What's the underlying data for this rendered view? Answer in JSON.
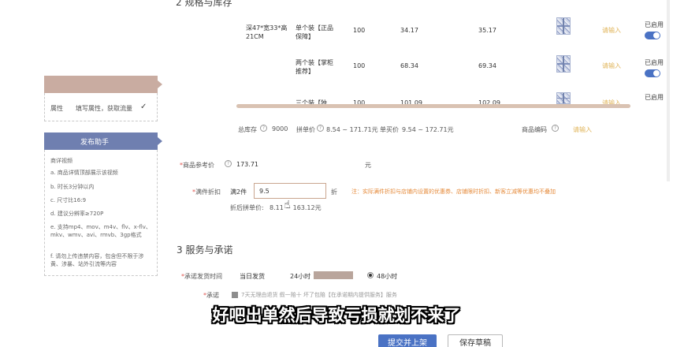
{
  "section2": {
    "title": "2  规格与库存"
  },
  "sku_rows": [
    {
      "spec": "深47*宽33*高21CM",
      "name": "单个装【正品保障】",
      "stock": "100",
      "group_price": "34.17",
      "single_price": "35.17",
      "code_placeholder": "请输入",
      "status": "已启用"
    },
    {
      "spec": "",
      "name": "两个装【掌柜推荐】",
      "stock": "100",
      "group_price": "68.34",
      "single_price": "69.34",
      "code_placeholder": "请输入",
      "status": "已启用"
    },
    {
      "spec": "",
      "name": "三个装【独",
      "stock": "100",
      "group_price": "101.09",
      "single_price": "102.09",
      "code_placeholder": "请输入",
      "status": "已启用"
    }
  ],
  "summary": {
    "total_stock_label": "总库存",
    "total_stock_value": "9000",
    "group_price_label": "拼单价",
    "group_price_range": "8.54 ~ 171.71元",
    "single_price_label": "单买价",
    "single_price_range": "9.54 ~ 172.71元",
    "product_code_label": "商品编码",
    "product_code_placeholder": "请输入"
  },
  "guide": {
    "top_label": "",
    "attr_label": "属性",
    "attr_hint": "填写属性，获取流量",
    "check_mark": "✓"
  },
  "helper": {
    "title": "发布助手",
    "tips": [
      "商详视频",
      "a. 商品详情顶部展示该视频",
      "b. 时长3分钟以内",
      "c. 尺寸比16:9",
      "d. 建议分辨率≥720P",
      "e. 支持mp4、mov、m4v、flv、x-flv、mkv、wmv、avi、rmvb、3gp格式",
      "f. 请勿上传违禁内容，包含但不限于涉黄、涉暴、站外引流等内容"
    ]
  },
  "reference_price": {
    "label": "商品参考价",
    "value": "173.71",
    "unit": "元"
  },
  "discount": {
    "label": "满件折扣",
    "prefix": "满2件",
    "value": "9.5",
    "suffix": "折",
    "note": "注：实际满件折扣与店铺内设置的优惠券、店铺限时折扣、新客立减等优惠均不叠加",
    "after_label": "折后拼单价:",
    "after_value": "8.11 ~ 163.12元"
  },
  "section3": {
    "title": "3  服务与承诺",
    "ship_label": "承诺发货时间",
    "options": [
      "当日发货",
      "24小时",
      "48小时"
    ],
    "promise_label": "承诺",
    "promise_text": "7天无理由退货  假一赔十  坏了包赔【在承诺期内提供服务】服务"
  },
  "subtitle": "好吧出单然后导致亏损就划不来了",
  "buttons": {
    "submit": "提交并上架",
    "draft": "保存草稿"
  },
  "colors": {
    "accent": "#4a72c4",
    "guide_header": "#6f7fb0",
    "highlight": "#c9aca1"
  }
}
